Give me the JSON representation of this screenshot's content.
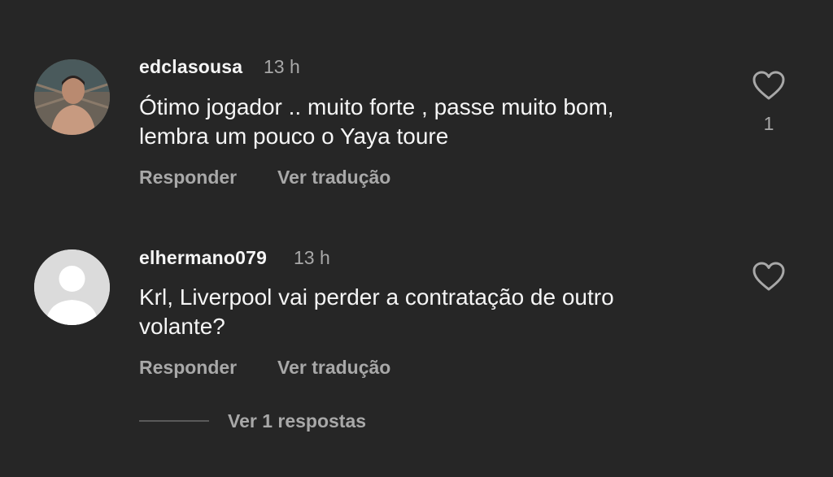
{
  "colors": {
    "background": "#262626",
    "primary_text": "#f5f5f5",
    "secondary_text": "#a8a8a8"
  },
  "comments": [
    {
      "username": "edclasousa",
      "time": "13 h",
      "text_line1": "Ótimo jogador .. muito forte , passe muito bom,",
      "text_line2": "lembra um pouco o Yaya toure",
      "reply_label": "Responder",
      "translate_label": "Ver tradução",
      "like_icon": "heart-outline-icon",
      "like_count": "1"
    },
    {
      "username": "elhermano079",
      "time": "13 h",
      "text_line1": "Krl, Liverpool vai perder a contratação de outro",
      "text_line2": "volante?",
      "reply_label": "Responder",
      "translate_label": "Ver tradução",
      "like_icon": "heart-outline-icon"
    }
  ],
  "view_replies_label": "Ver 1 respostas"
}
